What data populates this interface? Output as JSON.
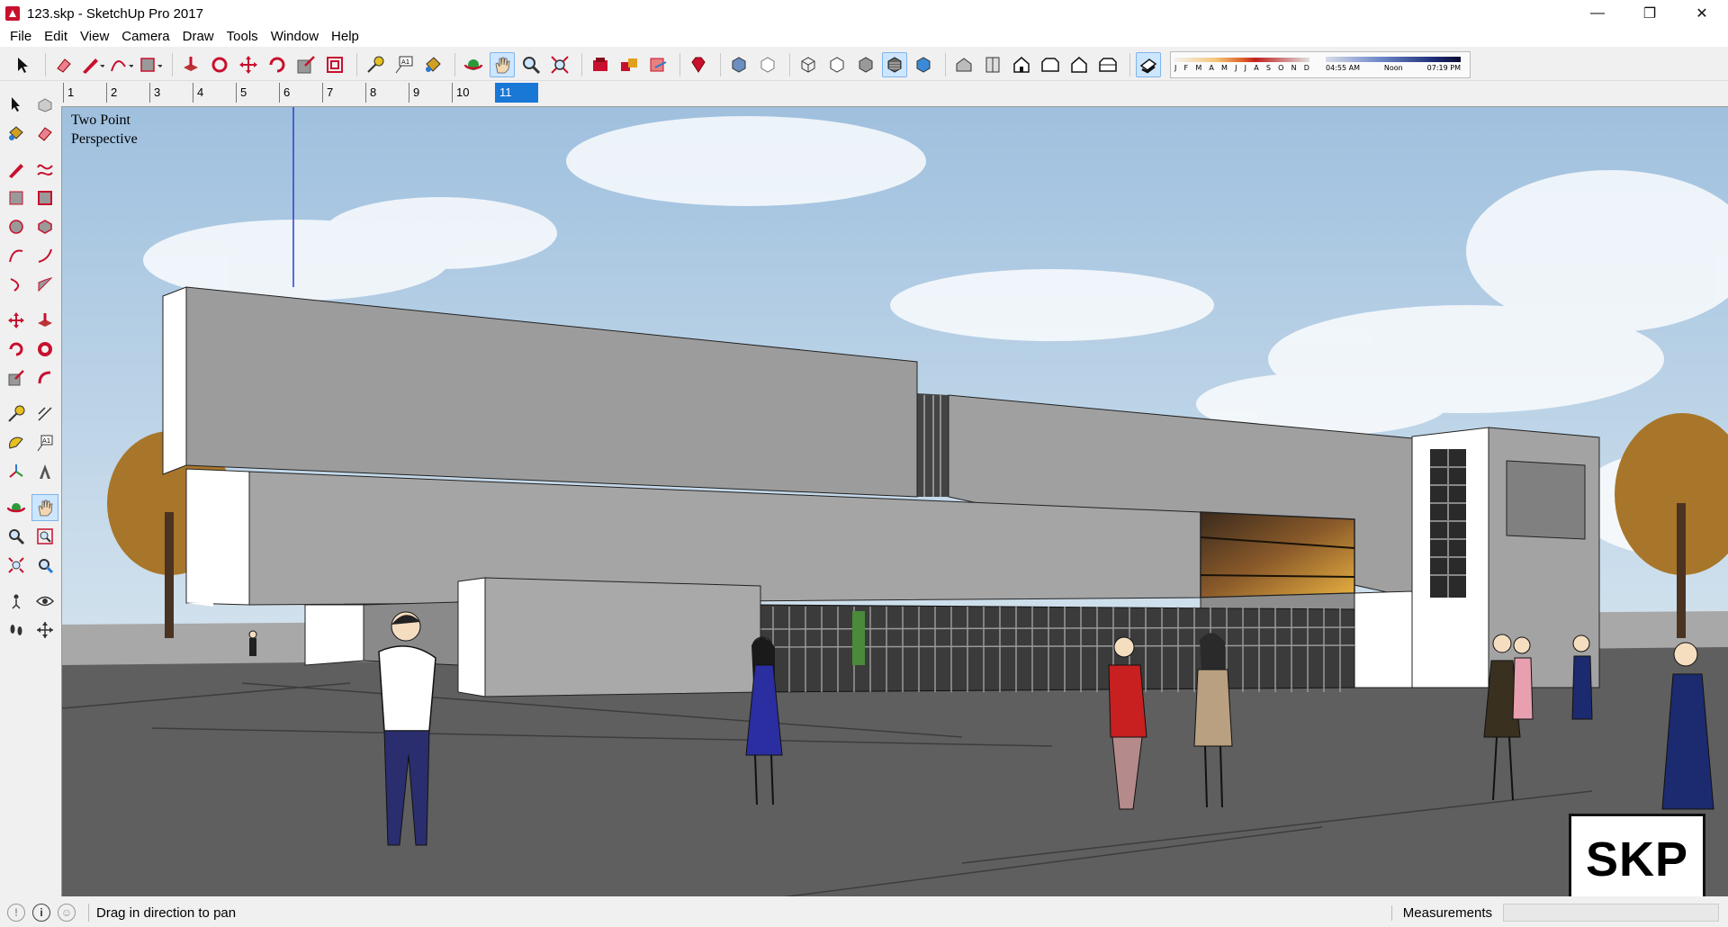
{
  "window": {
    "title": "123.skp - SketchUp Pro 2017",
    "controls": {
      "minimize": "—",
      "maximize": "❐",
      "close": "✕"
    }
  },
  "menu": [
    "File",
    "Edit",
    "View",
    "Camera",
    "Draw",
    "Tools",
    "Window",
    "Help"
  ],
  "toolbar": {
    "months": [
      "J",
      "F",
      "M",
      "A",
      "M",
      "J",
      "J",
      "A",
      "S",
      "O",
      "N",
      "D"
    ],
    "time_start": "04:55 AM",
    "time_mid": "Noon",
    "time_end": "07:19 PM"
  },
  "scene_tabs": [
    "1",
    "2",
    "3",
    "4",
    "5",
    "6",
    "7",
    "8",
    "9",
    "10",
    "11"
  ],
  "selected_scene": "11",
  "viewport": {
    "perspective_line1": "Two Point",
    "perspective_line2": "Perspective",
    "watermark": "SKP"
  },
  "status": {
    "message": "Drag in direction to pan",
    "measurements_label": "Measurements",
    "measurements_value": ""
  },
  "colors": {
    "active_tool_bg": "#cde6ff",
    "selected_tab": "#1977d6",
    "tool_red": "#c8102e"
  }
}
